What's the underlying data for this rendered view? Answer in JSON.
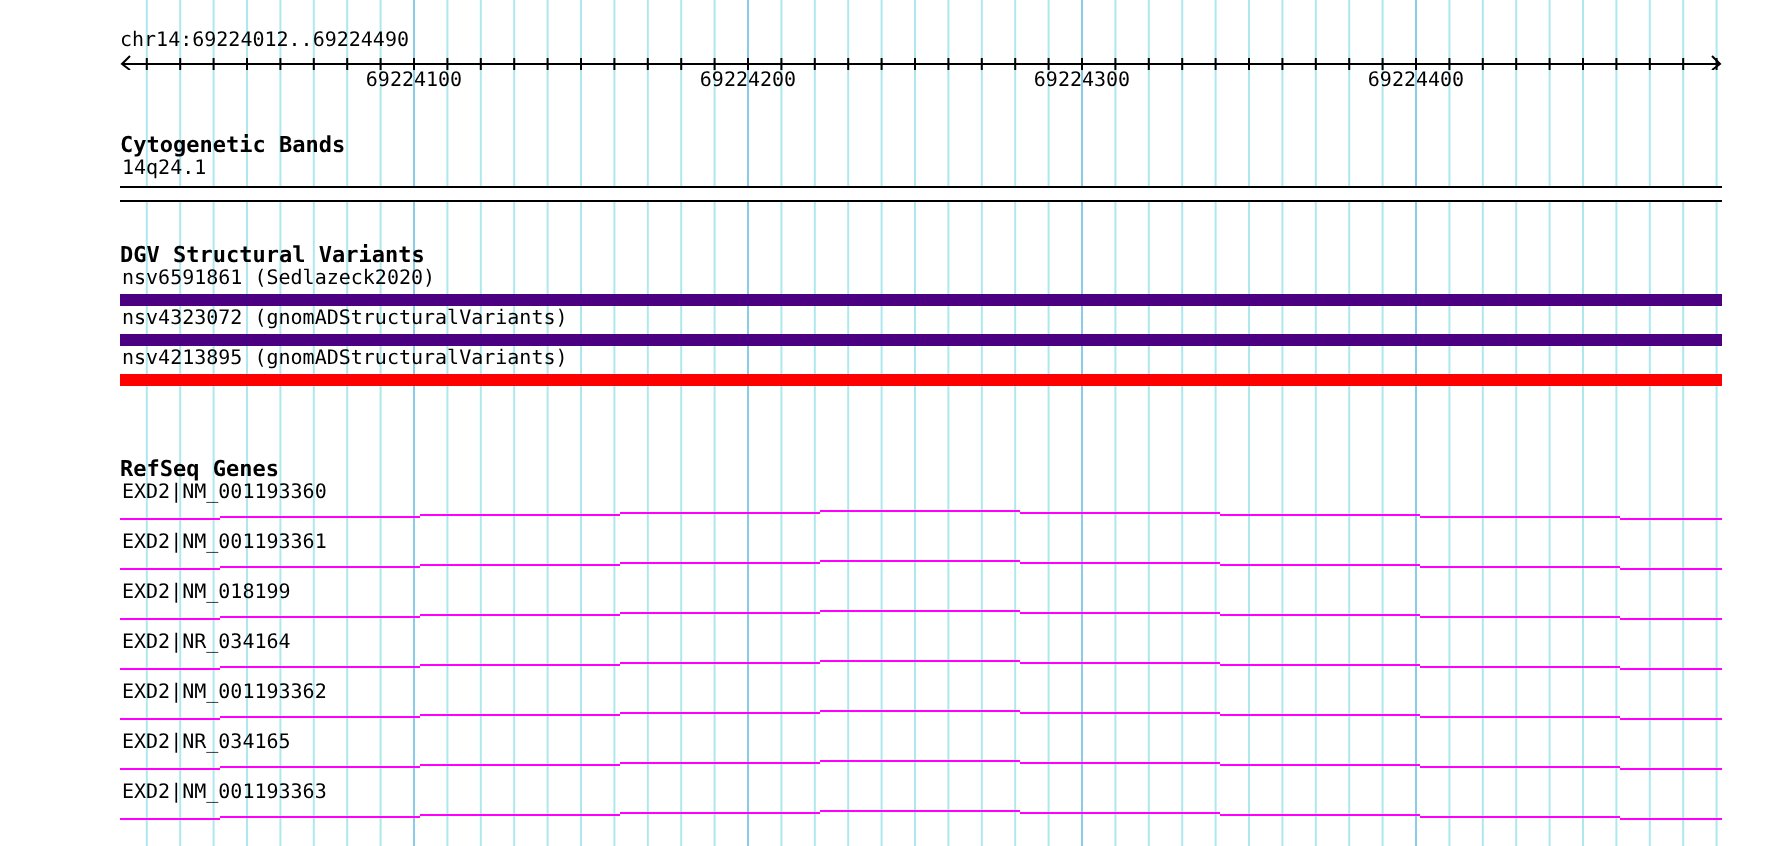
{
  "ruler": {
    "region": "chr14:69224012..69224490",
    "tick_labels": [
      "69224100",
      "69224200",
      "69224300",
      "69224400"
    ]
  },
  "tracks": [
    {
      "kind": "cytoband",
      "title": "Cytogenetic Bands",
      "features": [
        {
          "label": "14q24.1"
        }
      ]
    },
    {
      "kind": "variants",
      "title": "DGV Structural Variants",
      "features": [
        {
          "label": "nsv6591861 (Sedlazeck2020)",
          "color": "#4b0082"
        },
        {
          "label": "nsv4323072 (gnomADStructuralVariants)",
          "color": "#4b0082"
        },
        {
          "label": "nsv4213895 (gnomADStructuralVariants)",
          "color": "#ff0000"
        }
      ]
    },
    {
      "kind": "genes",
      "title": "RefSeq Genes",
      "features": [
        {
          "label": "EXD2|NM_001193360"
        },
        {
          "label": "EXD2|NM_001193361"
        },
        {
          "label": "EXD2|NM_018199"
        },
        {
          "label": "EXD2|NR_034164"
        },
        {
          "label": "EXD2|NM_001193362"
        },
        {
          "label": "EXD2|NR_034165"
        },
        {
          "label": "EXD2|NM_001193363"
        }
      ]
    }
  ]
}
